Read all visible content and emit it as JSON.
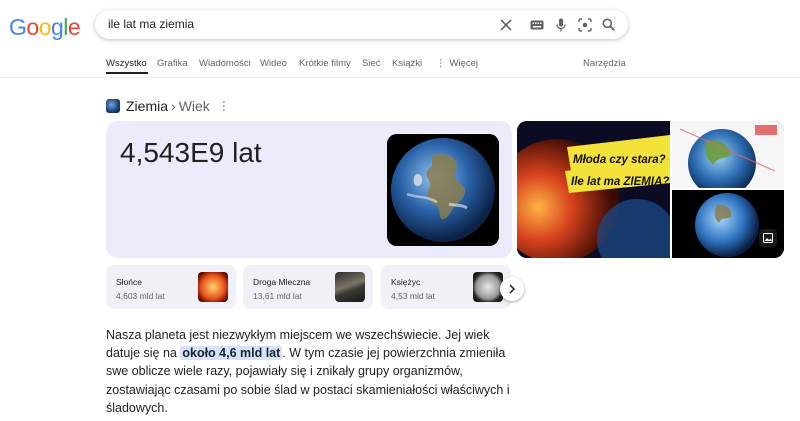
{
  "logo": {
    "text": "Google",
    "colors": [
      "#4285F4",
      "#EA4335",
      "#FBBC05",
      "#4285F4",
      "#34A853",
      "#EA4335"
    ]
  },
  "search": {
    "query": "ile lat ma ziemia"
  },
  "tabs": [
    {
      "label": "Wszystko",
      "active": true
    },
    {
      "label": "Grafika"
    },
    {
      "label": "Wiadomości"
    },
    {
      "label": "Wideo"
    },
    {
      "label": "Krótkie filmy"
    },
    {
      "label": "Sieć"
    },
    {
      "label": "Książki"
    },
    {
      "label": "Więcej"
    }
  ],
  "tools_label": "Narzędzia",
  "breadcrumb": {
    "entity": "Ziemia",
    "arrow": "›",
    "attribute": "Wiek"
  },
  "answer": {
    "value": "4,543E9 lat"
  },
  "collage": {
    "caption_line1": "Młoda czy stara?",
    "caption_line2": "Ile lat ma ZIEMIA?"
  },
  "related": [
    {
      "name": "Słońce",
      "age": "4,603 mld lat"
    },
    {
      "name": "Droga Mleczna",
      "age": "13,61 mld lat"
    },
    {
      "name": "Księżyc",
      "age": "4,53 mld lat"
    }
  ],
  "description": {
    "before": "Nasza planeta jest niezwykłym miejscem we wszechświecie. Jej wiek datuje się na ",
    "highlight": "około 4,6 mld lat",
    "after": ". W tym czasie jej powierzchnia zmieniła swe oblicze wiele razy, pojawiały się i znikały grupy organizmów, zostawiając czasami po sobie ślad w postaci skamieniałości właściwych i śladowych."
  }
}
